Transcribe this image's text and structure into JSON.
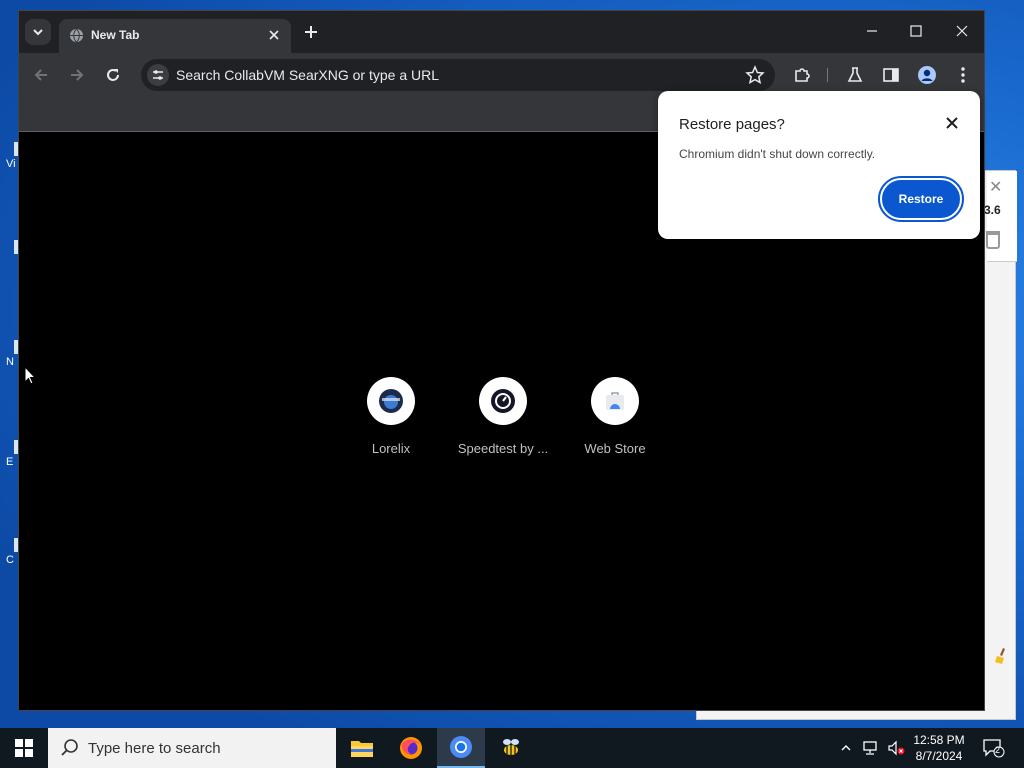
{
  "browser": {
    "tab_title": "New Tab",
    "omnibox_placeholder": "Search CollabVM SearXNG or type a URL",
    "shortcuts": [
      {
        "label": "Lorelix",
        "icon": "lorelix-icon"
      },
      {
        "label": "Speedtest by ...",
        "icon": "speedtest-icon"
      },
      {
        "label": "Web Store",
        "icon": "web-store-icon"
      }
    ]
  },
  "restore_popup": {
    "title": "Restore pages?",
    "message": "Chromium didn't shut down correctly.",
    "restore_label": "Restore"
  },
  "background_window": {
    "version_fragment": "3.6"
  },
  "desktop_icons": [
    {
      "label": "Vi"
    },
    {
      "label": ""
    },
    {
      "label": "N"
    },
    {
      "label": "E"
    },
    {
      "label": "C"
    }
  ],
  "taskbar": {
    "search_placeholder": "Type here to search",
    "apps": [
      "file-explorer-icon",
      "firefox-icon",
      "chromium-icon",
      "bee-app-icon"
    ],
    "time": "12:58 PM",
    "date": "8/7/2024",
    "notification_count": "2"
  },
  "colors": {
    "accent": "#0b57d0",
    "browser_dark": "#202124",
    "toolbar": "#35363a"
  }
}
